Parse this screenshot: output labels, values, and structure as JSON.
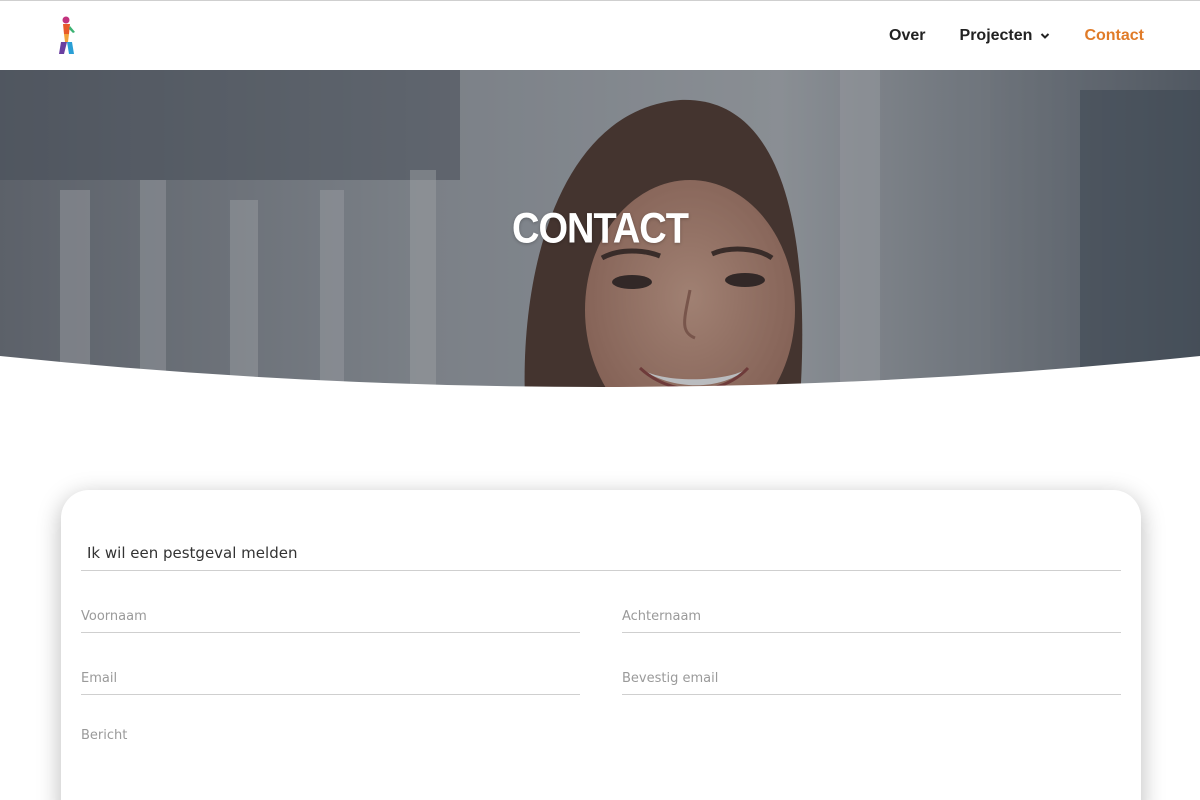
{
  "nav": {
    "items": [
      {
        "label": "Over"
      },
      {
        "label": "Projecten"
      },
      {
        "label": "Contact"
      }
    ]
  },
  "hero": {
    "title": "CONTACT"
  },
  "form": {
    "reason_value": "Ik wil een pestgeval melden",
    "first_name_placeholder": "Voornaam",
    "last_name_placeholder": "Achternaam",
    "email_placeholder": "Email",
    "confirm_email_placeholder": "Bevestig email",
    "message_placeholder": "Bericht"
  },
  "colors": {
    "accent": "#e07b28",
    "text": "#222222"
  }
}
